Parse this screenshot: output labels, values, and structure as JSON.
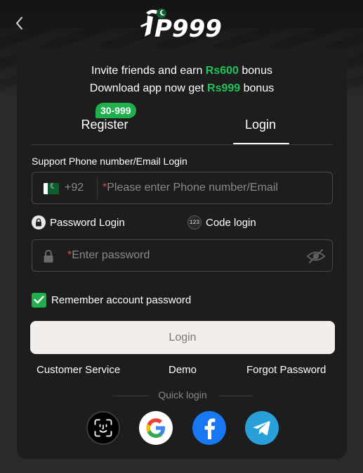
{
  "header": {
    "logo_text": "P999",
    "back_icon": "chevron-left-icon"
  },
  "promo": {
    "line1_prefix": "Invite friends and earn ",
    "line1_amount": "Rs600",
    "line1_suffix": " bonus",
    "line2_prefix": "Download app now get ",
    "line2_amount": "Rs999",
    "line2_suffix": " bonus"
  },
  "tabs": {
    "register_label": "Register",
    "register_badge": "30-999",
    "login_label": "Login",
    "active": "Login"
  },
  "form": {
    "phone_label": "Support Phone number/Email Login",
    "country_code": "+92",
    "phone_placeholder": "Please enter Phone number/Email",
    "required_mark": "*",
    "password_mode_label": "Password Login",
    "code_mode_label": "Code login",
    "code_mode_icon_text": "123",
    "password_placeholder": "Enter password",
    "remember_label": "Remember account password",
    "remember_checked": true,
    "login_button": "Login"
  },
  "links": {
    "customer_service": "Customer Service",
    "demo": "Demo",
    "forgot_password": "Forgot Password"
  },
  "quick_login": {
    "label": "Quick login",
    "providers": [
      "face-id-icon",
      "google-icon",
      "facebook-icon",
      "telegram-icon"
    ]
  },
  "colors": {
    "accent_green": "#21c25a",
    "badge_green": "#1fb04d",
    "panel": "#1d1d1d",
    "login_button_bg": "#f2eeea",
    "required_red": "#e04848"
  }
}
